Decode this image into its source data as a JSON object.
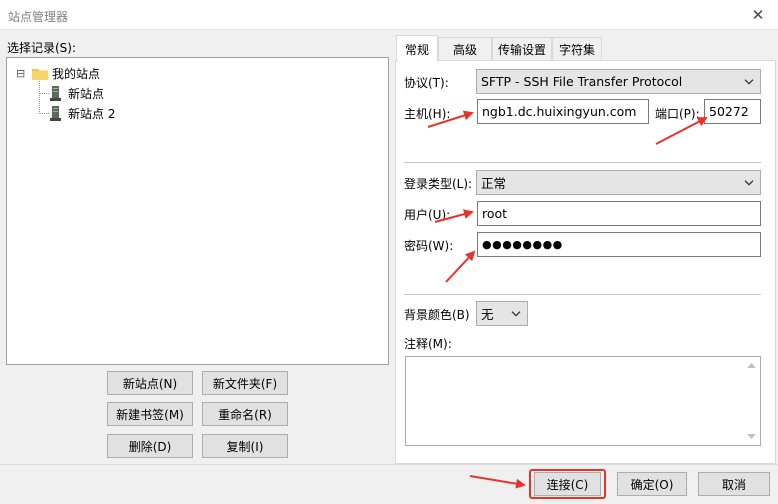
{
  "window": {
    "title": "站点管理器",
    "close_glyph": "✕"
  },
  "left": {
    "select_label": "选择记录(S):",
    "tree": {
      "expander": "⊟",
      "root_label": "我的站点",
      "children": [
        {
          "label": "新站点"
        },
        {
          "label": "新站点 2"
        }
      ]
    },
    "buttons": {
      "new_site": "新站点(N)",
      "new_folder": "新文件夹(F)",
      "new_bookmark": "新建书签(M)",
      "rename": "重命名(R)",
      "delete": "删除(D)",
      "copy": "复制(I)"
    }
  },
  "tabs": [
    {
      "label": "常规",
      "active": true
    },
    {
      "label": "高级",
      "active": false
    },
    {
      "label": "传输设置",
      "active": false
    },
    {
      "label": "字符集",
      "active": false
    }
  ],
  "general": {
    "protocol": {
      "label": "协议(T):",
      "value": "SFTP - SSH File Transfer Protocol"
    },
    "host": {
      "label": "主机(H):",
      "value": "ngb1.dc.huixingyun.com"
    },
    "port": {
      "label": "端口(P):",
      "value": "50272"
    },
    "logon_type": {
      "label": "登录类型(L):",
      "value": "正常"
    },
    "user": {
      "label": "用户(U):",
      "value": "root"
    },
    "password": {
      "label": "密码(W):",
      "value": "●●●●●●●●"
    },
    "background_color": {
      "label": "背景颜色(B)",
      "value": "无"
    },
    "comments": {
      "label": "注释(M):",
      "value": ""
    }
  },
  "footer": {
    "connect": "连接(C)",
    "ok": "确定(O)",
    "cancel": "取消"
  },
  "colors": {
    "annotation_red": "#e8332a",
    "folder_yellow": "#f5c542"
  },
  "icons": [
    "folder-icon",
    "server-icon",
    "chevron-down-icon",
    "close-icon",
    "scroll-up-icon",
    "scroll-down-icon"
  ]
}
